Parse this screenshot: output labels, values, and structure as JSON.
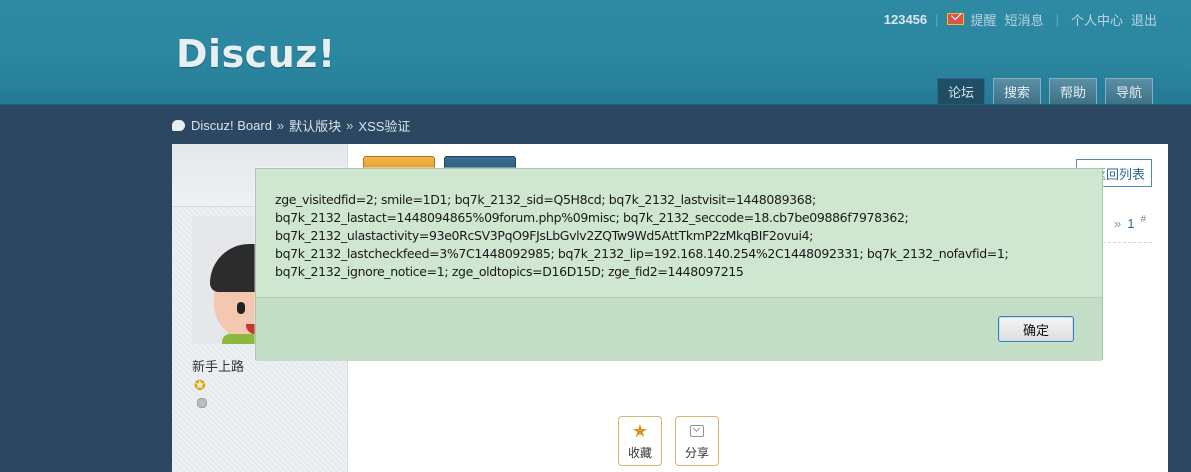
{
  "header": {
    "logo": "Discuz!",
    "topbar": {
      "username": "123456",
      "sep": "|",
      "remind": "提醒",
      "messages": "短消息",
      "profile": "个人中心",
      "logout": "退出"
    },
    "tabs": [
      {
        "label": "论坛",
        "active": true
      },
      {
        "label": "搜索",
        "active": false
      },
      {
        "label": "帮助",
        "active": false
      },
      {
        "label": "导航",
        "active": false
      }
    ]
  },
  "breadcrumb": {
    "items": [
      "Discuz! Board",
      "默认版块",
      "XSS验证"
    ],
    "separator": "»"
  },
  "thread": {
    "back_to_list": "返回列表",
    "pager": {
      "next": "»",
      "page": "1",
      "floor_mark": "#"
    },
    "author": {
      "rank": "新手上路"
    },
    "actions": {
      "favorite": "收藏",
      "share": "分享"
    }
  },
  "dialog": {
    "message_lines": [
      "zge_visitedfid=2; smile=1D1; bq7k_2132_sid=Q5H8cd; bq7k_2132_lastvisit=1448089368;",
      "bq7k_2132_lastact=1448094865%09forum.php%09misc; bq7k_2132_seccode=18.cb7be09886f7978362;",
      "bq7k_2132_ulastactivity=93e0RcSV3PqO9FJsLbGvlv2ZQTw9Wd5AttTkmP2zMkqBIF2ovui4;",
      "bq7k_2132_lastcheckfeed=3%7C1448092985; bq7k_2132_lip=192.168.140.254%2C1448092331; bq7k_2132_nofavfid=1;",
      "bq7k_2132_ignore_notice=1; zge_oldtopics=D16D15D; zge_fid2=1448097215"
    ],
    "ok_label": "确定"
  },
  "colors": {
    "header_bg": "#2e8aa3",
    "page_bg": "#2c4762",
    "dialog_bg": "#cfe6d0",
    "link": "#2b6a92"
  }
}
